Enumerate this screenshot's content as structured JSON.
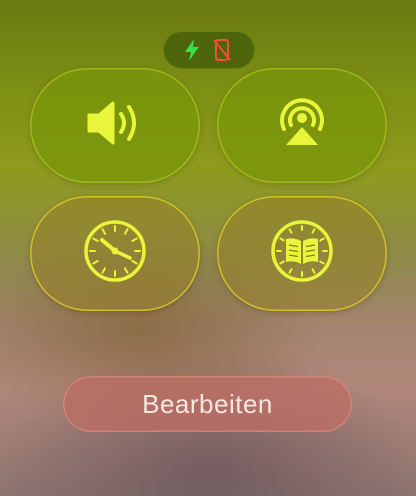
{
  "status": {
    "icons": [
      "charging-bolt-icon",
      "phone-disconnected-icon"
    ],
    "charging_color": "#35e04a",
    "disconnected_color": "#ff4a3a"
  },
  "controls": [
    {
      "icon": "speaker-volume-icon"
    },
    {
      "icon": "airplay-audio-icon"
    },
    {
      "icon": "clock-icon"
    },
    {
      "icon": "book-icon"
    }
  ],
  "edit_button": {
    "label": "Bearbeiten"
  },
  "colors": {
    "icon_accent": "#e8f53a",
    "tile_fill": "#7c9a0c",
    "edit_fill": "#c07a6c"
  }
}
